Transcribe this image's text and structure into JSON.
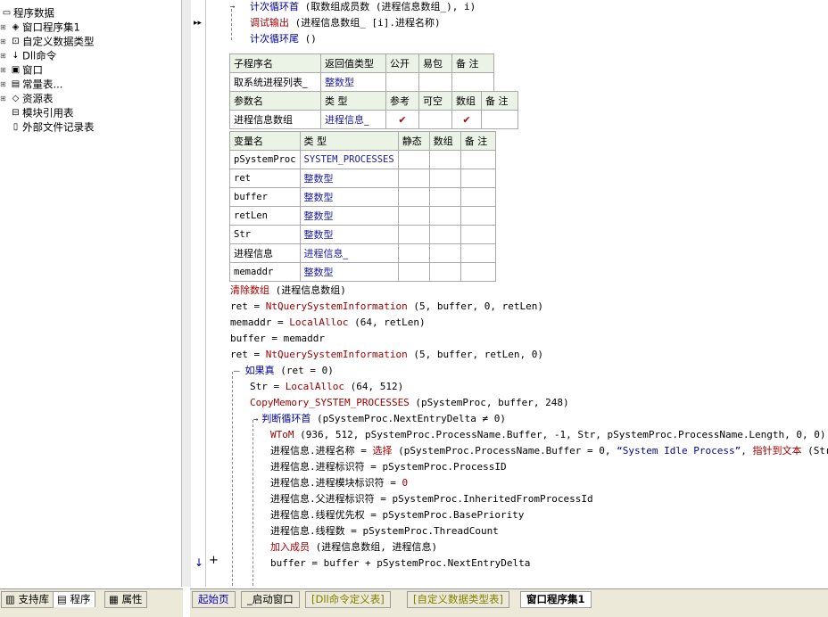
{
  "sidebar": {
    "items": [
      {
        "label": "程序数据",
        "icon": "folder-icon"
      },
      {
        "label": "窗口程序集1",
        "icon": "module-icon"
      },
      {
        "label": "自定义数据类型",
        "icon": "type-icon"
      },
      {
        "label": "Dll命令",
        "icon": "dll-icon"
      },
      {
        "label": "窗口",
        "icon": "window-icon"
      },
      {
        "label": "常量表...",
        "icon": "constant-icon"
      },
      {
        "label": "资源表",
        "icon": "resource-icon"
      },
      {
        "label": "模块引用表",
        "icon": "module-ref-icon"
      },
      {
        "label": "外部文件记录表",
        "icon": "file-icon"
      }
    ],
    "tabs": [
      {
        "label": "支持库",
        "active": false
      },
      {
        "label": "程序",
        "active": true
      },
      {
        "label": "属性",
        "active": false
      }
    ]
  },
  "editor_tabs": [
    {
      "label": "起始页",
      "active": false
    },
    {
      "label": "_启动窗口",
      "active": false
    },
    {
      "label": "[Dll命令定义表]",
      "active": false
    },
    {
      "label": "[自定义数据类型表]",
      "active": false
    },
    {
      "label": "窗口程序集1",
      "active": true
    }
  ],
  "code_top": {
    "line1_kw": "计次循环首",
    "line1_rest": " (取数组成员数 (进程信息数组_), i)",
    "line2_fn": "调试输出",
    "line2_rest": " (进程信息数组_ [i].进程名称)",
    "line3_kw": "计次循环尾",
    "line3_rest": " ()"
  },
  "sub_table": {
    "headers": [
      "子程序名",
      "返回值类型",
      "公开",
      "易包",
      "备 注"
    ],
    "row": [
      "取系统进程列表_",
      "整数型",
      "",
      "",
      ""
    ]
  },
  "param_table": {
    "headers": [
      "参数名",
      "类 型",
      "参考",
      "可空",
      "数组",
      "备 注"
    ],
    "row": [
      "进程信息数组",
      "进程信息_",
      "✔",
      "",
      "✔",
      ""
    ]
  },
  "var_table": {
    "headers": [
      "变量名",
      "类 型",
      "静态",
      "数组",
      "备 注"
    ],
    "rows": [
      [
        "pSystemProc",
        "SYSTEM_PROCESSES"
      ],
      [
        "ret",
        "整数型"
      ],
      [
        "buffer",
        "整数型"
      ],
      [
        "retLen",
        "整数型"
      ],
      [
        "Str",
        "整数型"
      ],
      [
        "进程信息",
        "进程信息_"
      ],
      [
        "memaddr",
        "整数型"
      ]
    ]
  },
  "code_body": {
    "l1_fn": "清除数组",
    "l1_rest": " (进程信息数组)",
    "l2_a": "ret = ",
    "l2_fn": "NtQuerySystemInformation",
    "l2_b": " (5, buffer, 0, retLen)",
    "l3_a": "memaddr = ",
    "l3_fn": "LocalAlloc",
    "l3_b": " (64, retLen)",
    "l4": "buffer = memaddr",
    "l5_a": "ret = ",
    "l5_fn": "NtQuerySystemInformation",
    "l5_b": " (5, buffer, retLen, 0)",
    "l6_kw": "如果真",
    "l6_b": " (ret = 0)",
    "l7_a": "Str = ",
    "l7_fn": "LocalAlloc",
    "l7_b": " (64, 512)",
    "l8_fn": "CopyMemory_SYSTEM_PROCESSES",
    "l8_b": " (pSystemProc, buffer, 248)",
    "l9_kw": "判断循环首",
    "l9_b": " (pSystemProc.NextEntryDelta ≠ 0)",
    "l10_fn": "WToM",
    "l10_b": " (936, 512, pSystemProc.ProcessName.Buffer, -1, Str, pSystemProc.ProcessName.Length, 0, 0)",
    "l11_a": "进程信息.进程名称 = ",
    "l11_fn": "选择",
    "l11_b": " (pSystemProc.ProcessName.Buffer = 0, ",
    "l11_str": "“System Idle Process”",
    "l11_c": ", ",
    "l11_fn2": "指针到文本",
    "l11_d": " (Str",
    "l12": "进程信息.进程标识符 = pSystemProc.ProcessID",
    "l13_a": "进程信息.进程模块标识符 = ",
    "l13_num": "0",
    "l14": "进程信息.父进程标识符 = pSystemProc.InheritedFromProcessId",
    "l15": "进程信息.线程优先权 = pSystemProc.BasePriority",
    "l16": "进程信息.线程数 = pSystemProc.ThreadCount",
    "l17_fn": "加入成员",
    "l17_b": " (进程信息数组, 进程信息)",
    "l18": "buffer = buffer + pSystemProc.NextEntryDelta"
  }
}
